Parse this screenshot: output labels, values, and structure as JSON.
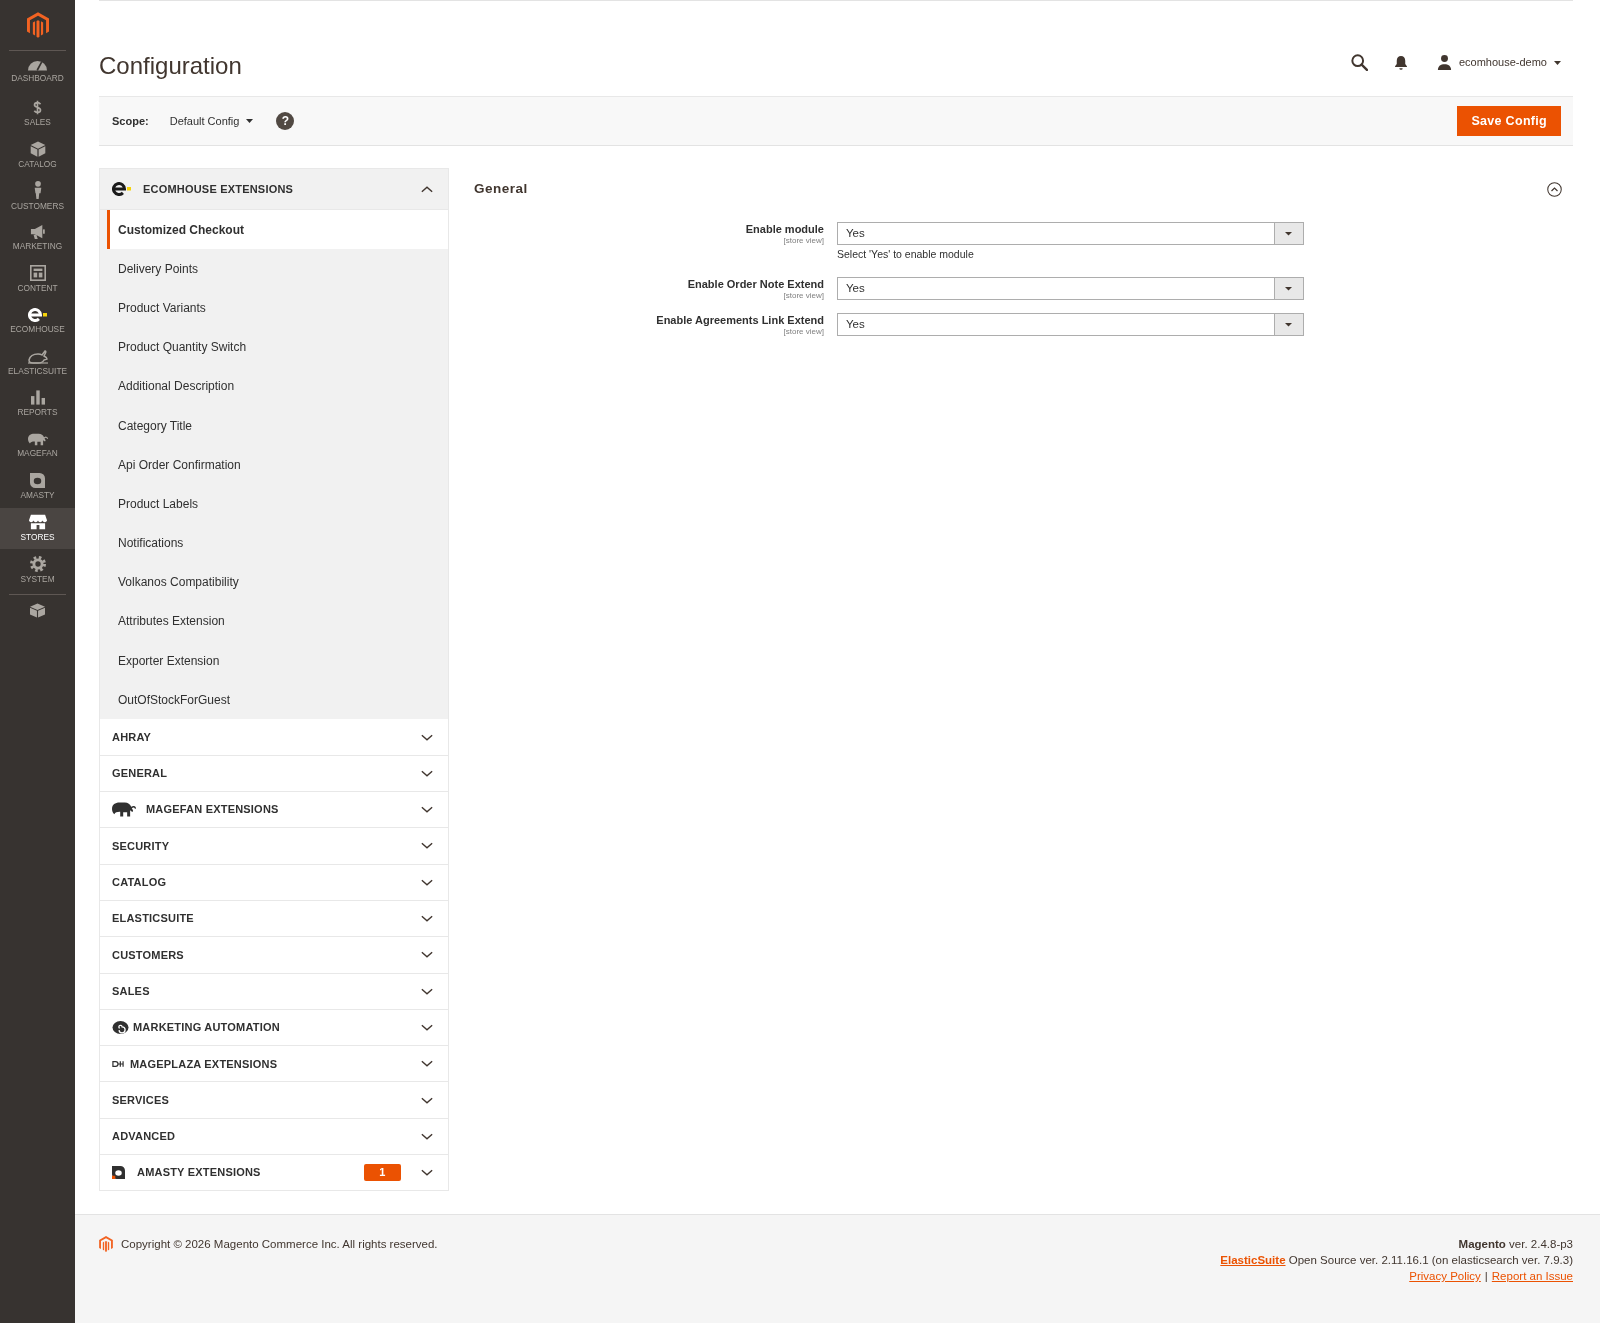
{
  "sidebar": {
    "items": [
      {
        "label": "DASHBOARD",
        "selected": false
      },
      {
        "label": "SALES",
        "selected": false
      },
      {
        "label": "CATALOG",
        "selected": false
      },
      {
        "label": "CUSTOMERS",
        "selected": false
      },
      {
        "label": "MARKETING",
        "selected": false
      },
      {
        "label": "CONTENT",
        "selected": false
      },
      {
        "label": "ECOMHOUSE",
        "selected": false
      },
      {
        "label": "ELASTICSUITE",
        "selected": false
      },
      {
        "label": "REPORTS",
        "selected": false
      },
      {
        "label": "MAGEFAN",
        "selected": false
      },
      {
        "label": "AMASTY",
        "selected": false
      },
      {
        "label": "STORES",
        "selected": true
      },
      {
        "label": "SYSTEM",
        "selected": false
      }
    ]
  },
  "header": {
    "title": "Configuration",
    "user_menu": {
      "username": "ecomhouse-demo"
    }
  },
  "scope_bar": {
    "label": "Scope:",
    "value": "Default Config",
    "help": "?",
    "save_button": "Save Config"
  },
  "config_nav": {
    "sections": [
      {
        "label": "ECOMHOUSE EXTENSIONS",
        "expanded": true,
        "children": [
          {
            "label": "Customized Checkout",
            "selected": true
          },
          {
            "label": "Delivery Points",
            "selected": false
          },
          {
            "label": "Product Variants",
            "selected": false
          },
          {
            "label": "Product Quantity Switch",
            "selected": false
          },
          {
            "label": "Additional Description",
            "selected": false
          },
          {
            "label": "Category Title",
            "selected": false
          },
          {
            "label": "Api Order Confirmation",
            "selected": false
          },
          {
            "label": "Product Labels",
            "selected": false
          },
          {
            "label": "Notifications",
            "selected": false
          },
          {
            "label": "Volkanos Compatibility",
            "selected": false
          },
          {
            "label": "Attributes Extension",
            "selected": false
          },
          {
            "label": "Exporter Extension",
            "selected": false
          },
          {
            "label": "OutOfStockForGuest",
            "selected": false
          }
        ]
      },
      {
        "label": "AHRAY",
        "expanded": false
      },
      {
        "label": "GENERAL",
        "expanded": false
      },
      {
        "label": "MAGEFAN EXTENSIONS",
        "expanded": false
      },
      {
        "label": "SECURITY",
        "expanded": false
      },
      {
        "label": "CATALOG",
        "expanded": false
      },
      {
        "label": "ELASTICSUITE",
        "expanded": false
      },
      {
        "label": "CUSTOMERS",
        "expanded": false
      },
      {
        "label": "SALES",
        "expanded": false
      },
      {
        "label": "MARKETING AUTOMATION",
        "expanded": false
      },
      {
        "label": "MAGEPLAZA EXTENSIONS",
        "expanded": false
      },
      {
        "label": "SERVICES",
        "expanded": false
      },
      {
        "label": "ADVANCED",
        "expanded": false
      },
      {
        "label": "AMASTY EXTENSIONS",
        "expanded": false,
        "badge": "1"
      }
    ]
  },
  "config_form": {
    "group": {
      "title": "General",
      "expanded": true,
      "fields": [
        {
          "label": "Enable module",
          "scope": "[store view]",
          "value": "Yes",
          "note": "Select 'Yes' to enable module"
        },
        {
          "label": "Enable Order Note Extend",
          "scope": "[store view]",
          "value": "Yes"
        },
        {
          "label": "Enable Agreements Link Extend",
          "scope": "[store view]",
          "value": "Yes"
        }
      ]
    }
  },
  "footer": {
    "copyright": "Copyright © 2026 Magento Commerce Inc. All rights reserved.",
    "version": "**Magento** ver. 2.4.8-p3",
    "search_engine": {
      "link": "ElasticSuite",
      "text": "Open Source ver. 2.11.16.1 (on elasticsearch ver. 7.9.3)"
    },
    "links": [
      "Privacy Policy",
      "Report an Issue"
    ],
    "separator": "|"
  }
}
